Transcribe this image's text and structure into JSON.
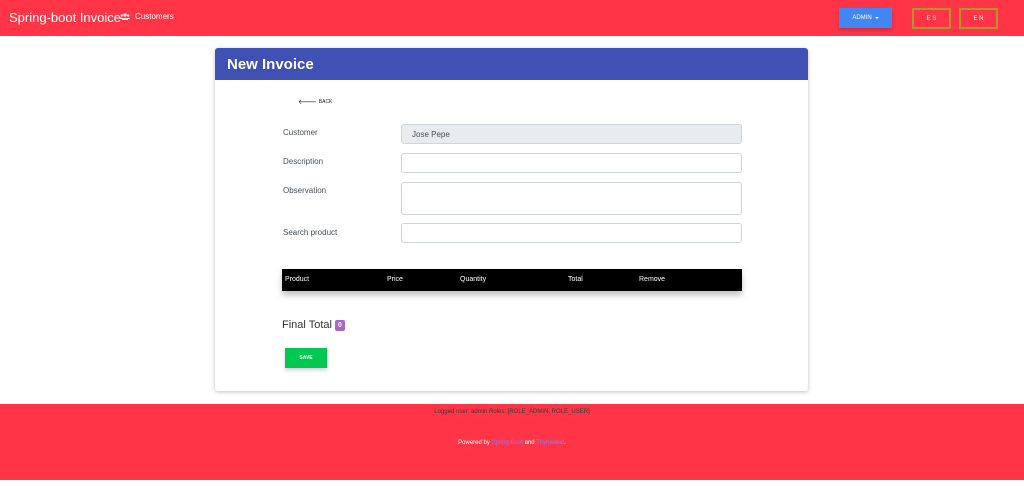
{
  "navbar": {
    "brand": "Spring-boot Invoice",
    "customers_label": "Customers",
    "admin_label": "ADMIN",
    "lang_es": "E S",
    "lang_en": "E N"
  },
  "card": {
    "title": "New Invoice",
    "back_label": "BACK",
    "customer_label": "Customer",
    "customer_value": "Jose Pepe",
    "description_label": "Description",
    "description_value": "",
    "observation_label": "Observation",
    "observation_value": "",
    "search_label": "Search product",
    "search_value": "",
    "table_headers": [
      "Product",
      "Price",
      "Quantity",
      "Total",
      "Remove"
    ],
    "final_total_label": "Final Total",
    "final_total_value": "0",
    "save_label": "SAVE"
  },
  "footer": {
    "user_info": "Logged user: admin Roles: [ROLE_ADMIN, ROLE_USER]",
    "powered_prefix": "Powered by",
    "link1": "Spring Boot",
    "and": "and",
    "link2": "Thymeleaf",
    "suffix": "."
  },
  "colors": {
    "navbar": "#ff3547",
    "card_header": "#3f51b5",
    "admin_button": "#4285f4",
    "save_button": "#00c851",
    "total_badge": "#aa66cc"
  },
  "icons": {
    "customers": "users-icon",
    "back": "arrow-left-icon",
    "admin_caret": "caret-down-icon"
  }
}
